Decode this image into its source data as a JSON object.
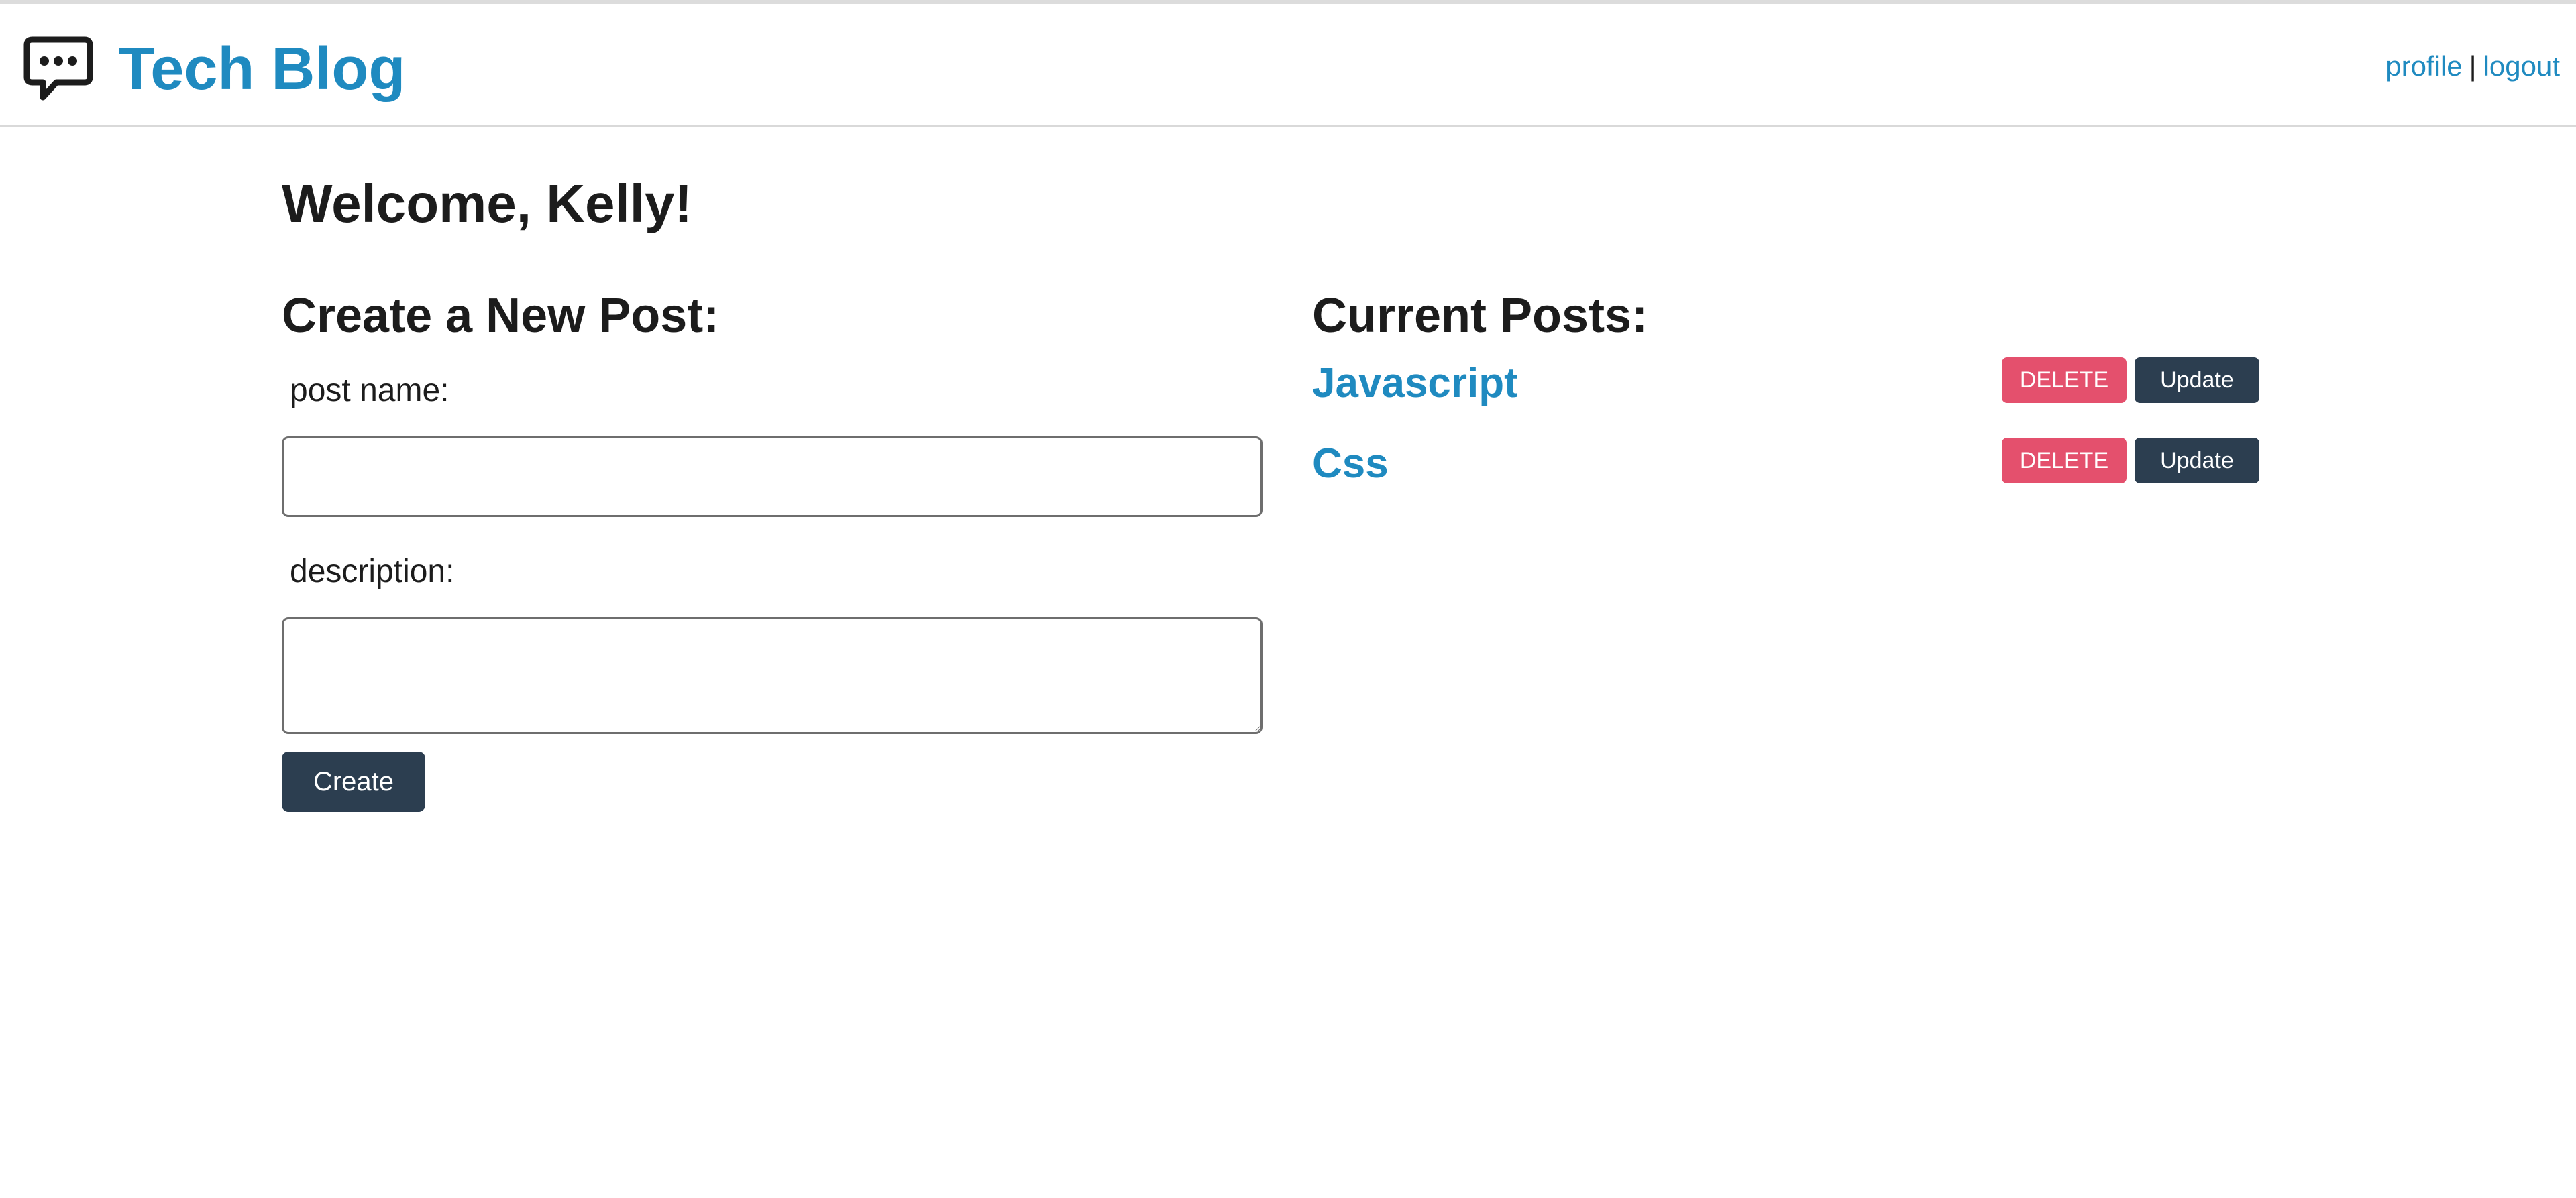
{
  "header": {
    "brand_icon": "chat-bubble-icon",
    "title": "Tech Blog",
    "nav": {
      "profile_label": "profile",
      "separator": "|",
      "logout_label": "logout"
    }
  },
  "main": {
    "welcome": "Welcome, Kelly!",
    "create": {
      "heading": "Create a New Post:",
      "post_name_label": "post name:",
      "post_name_value": "",
      "description_label": "description:",
      "description_value": "",
      "create_label": "Create"
    },
    "posts": {
      "heading": "Current Posts:",
      "items": [
        {
          "title": "Javascript",
          "delete_label": "DELETE",
          "update_label": "Update"
        },
        {
          "title": "Css",
          "delete_label": "DELETE",
          "update_label": "Update"
        }
      ]
    }
  },
  "colors": {
    "brand": "#1f8ac0",
    "dark_button": "#2c3e50",
    "delete_button": "#e4506d"
  }
}
